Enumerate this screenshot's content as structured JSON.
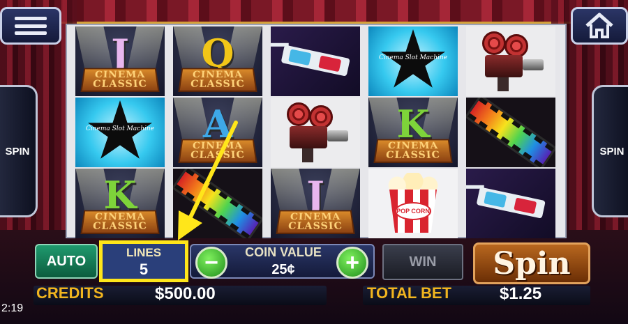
{
  "controls": {
    "side_spin_left": "SPIN",
    "side_spin_right": "SPIN",
    "auto": "AUTO",
    "lines_label": "LINES",
    "lines_value": "5",
    "coin_value_label": "COIN VALUE",
    "coin_value": "25¢",
    "coin_minus": "−",
    "coin_plus": "+",
    "win_label": "WIN",
    "spin_label": "Spin"
  },
  "meters": {
    "credits_label": "CREDITS",
    "credits_value": "$500.00",
    "total_bet_label": "TOTAL BET",
    "total_bet_value": "$1.25"
  },
  "status": {
    "clock": "2:19"
  },
  "symbol_text": {
    "cinema": "CINEMA",
    "classic": "CLASSIC",
    "star_text": "Cinema Slot Machine",
    "popcorn": "POP CORN"
  },
  "reels": [
    [
      "J",
      "star",
      "K"
    ],
    [
      "Q",
      "A",
      "film"
    ],
    [
      "glasses",
      "projector",
      "J"
    ],
    [
      "star",
      "K",
      "popcorn"
    ],
    [
      "projector",
      "film",
      "glasses"
    ]
  ],
  "annotation": {
    "highlight_color": "#ffe61a",
    "arrow_color": "#ffe61a"
  }
}
